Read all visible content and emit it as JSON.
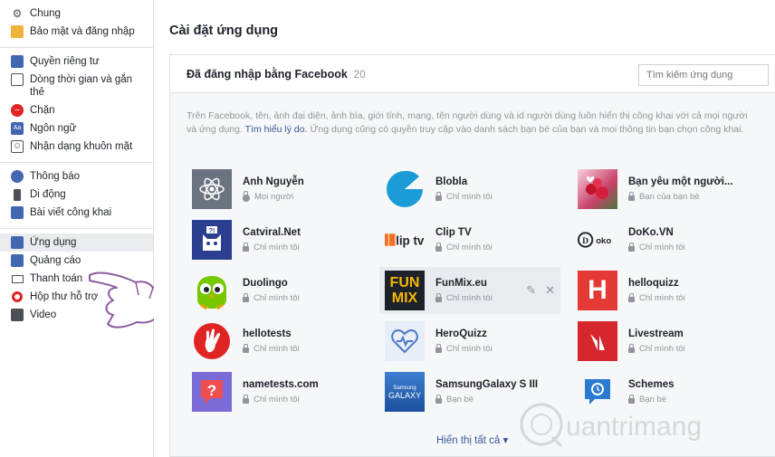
{
  "sidebar": {
    "groups": [
      [
        {
          "label": "Chung",
          "icon": "gear-icon"
        },
        {
          "label": "Bảo mật và đăng nhập",
          "icon": "shield-icon"
        }
      ],
      [
        {
          "label": "Quyền riêng tư",
          "icon": "lock-icon"
        },
        {
          "label": "Dòng thời gian và gắn thẻ",
          "icon": "timeline-icon"
        },
        {
          "label": "Chặn",
          "icon": "block-icon"
        },
        {
          "label": "Ngôn ngữ",
          "icon": "language-icon"
        },
        {
          "label": "Nhận dạng khuôn mặt",
          "icon": "face-icon"
        }
      ],
      [
        {
          "label": "Thông báo",
          "icon": "globe-icon"
        },
        {
          "label": "Di động",
          "icon": "mobile-icon"
        },
        {
          "label": "Bài viết công khai",
          "icon": "rss-icon"
        }
      ],
      [
        {
          "label": "Ứng dụng",
          "icon": "apps-icon"
        },
        {
          "label": "Quảng cáo",
          "icon": "ads-icon"
        },
        {
          "label": "Thanh toán",
          "icon": "card-icon"
        },
        {
          "label": "Hộp thư hỗ trợ",
          "icon": "lifebuoy-icon"
        },
        {
          "label": "Video",
          "icon": "film-icon"
        }
      ]
    ]
  },
  "main": {
    "title": "Cài đặt ứng dụng",
    "panel": {
      "title": "Đã đăng nhập bằng Facebook",
      "count": "20",
      "search_placeholder": "Tìm kiếm ứng dụng",
      "description_1": "Trên Facebook, tên, ảnh đại diện, ảnh bìa, giới tính, mạng, tên người dùng và id người dùng luôn hiển thị công khai với cả mọi người và ứng dụng.",
      "description_link": "Tìm hiểu lý do.",
      "description_2": "Ứng dụng cũng có quyền truy cập vào danh sách bạn bè của bạn và mọi thông tin bạn chọn công khai."
    },
    "apps": [
      {
        "name": "Anh Nguyễn",
        "privacy": "Mọi người",
        "icon": "atom-icon"
      },
      {
        "name": "Blobla",
        "privacy": "Chỉ mình tôi",
        "icon": "blobla-icon"
      },
      {
        "name": "Bạn yêu một người...",
        "privacy": "Bạn của bạn bè",
        "icon": "roses-icon"
      },
      {
        "name": "Catviral.Net",
        "privacy": "Chỉ mình tôi",
        "icon": "cat-icon"
      },
      {
        "name": "Clip TV",
        "privacy": "Chỉ mình tôi",
        "icon": "cliptv-icon"
      },
      {
        "name": "DoKo.VN",
        "privacy": "Chỉ mình tôi",
        "icon": "doko-icon"
      },
      {
        "name": "Duolingo",
        "privacy": "Chỉ mình tôi",
        "icon": "owl-icon"
      },
      {
        "name": "FunMix.eu",
        "privacy": "Chỉ mình tôi",
        "icon": "funmix-icon"
      },
      {
        "name": "helloquizz",
        "privacy": "Chỉ mình tôi",
        "icon": "h-icon"
      },
      {
        "name": "hellotests",
        "privacy": "Chỉ mình tôi",
        "icon": "hand-icon"
      },
      {
        "name": "HeroQuizz",
        "privacy": "Chỉ mình tôi",
        "icon": "heart-icon"
      },
      {
        "name": "Livestream",
        "privacy": "Chỉ mình tôi",
        "icon": "livestream-icon"
      },
      {
        "name": "nametests.com",
        "privacy": "Chỉ mình tôi",
        "icon": "question-icon"
      },
      {
        "name": "SamsungGalaxy S III",
        "privacy": "Bạn bè",
        "icon": "galaxy-icon"
      },
      {
        "name": "Schemes",
        "privacy": "Bạn bè",
        "icon": "schemes-icon"
      }
    ],
    "show_all": "Hiển thị tất cả ▾"
  },
  "watermark": {
    "text": "uantrimang"
  }
}
